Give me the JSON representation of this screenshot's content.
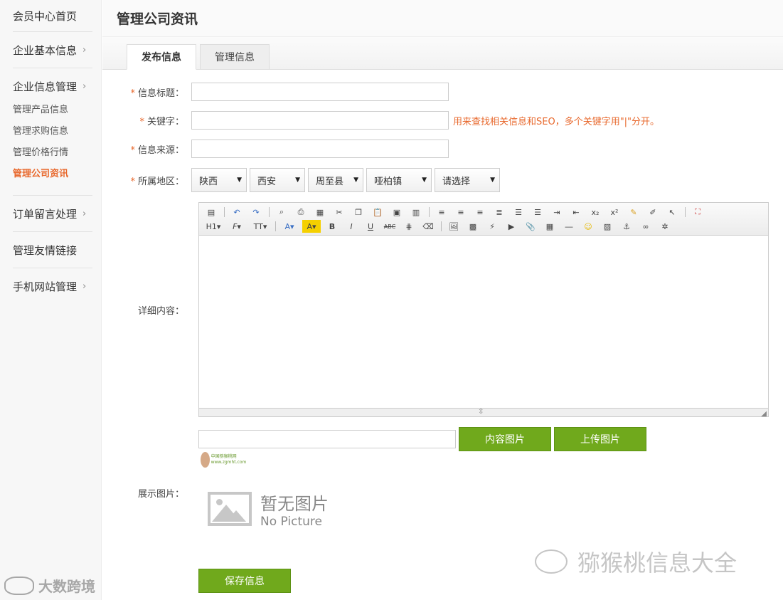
{
  "sidebar": {
    "home": "会员中心首页",
    "basic": "企业基本信息",
    "info_manage": "企业信息管理",
    "sub_items": [
      "管理产品信息",
      "管理求购信息",
      "管理价格行情",
      "管理公司资讯"
    ],
    "orders": "订单留言处理",
    "links": "管理友情链接",
    "mobile": "手机网站管理"
  },
  "page_title": "管理公司资讯",
  "tabs": [
    "发布信息",
    "管理信息"
  ],
  "form": {
    "title_label": "信息标题：",
    "keyword_label": "关键字：",
    "keyword_hint": "用来查找相关信息和SEO，多个关键字用\"|\"分开。",
    "source_label": "信息来源：",
    "region_label": "所属地区：",
    "regions": [
      "陕西",
      "西安",
      "周至县",
      "哑柏镇",
      "请选择"
    ],
    "content_label": "详细内容：",
    "toolbar_row2": [
      "H1",
      "F",
      "TT",
      "A",
      "A",
      "B",
      "I",
      "U",
      "ABC"
    ],
    "btn_content_image": "内容图片",
    "btn_upload_image": "上传图片",
    "thumb_text": "中国猕猴桃网 www.zgmht.com",
    "display_label": "展示图片：",
    "no_pic_cn": "暂无图片",
    "no_pic_en": "No Picture",
    "save_button": "保存信息",
    "required_mark": "*"
  },
  "watermarks": {
    "right": "猕猴桃信息大全",
    "left": "大数跨境"
  },
  "colors": {
    "accent_orange": "#e8682c",
    "button_green": "#70a91c"
  }
}
